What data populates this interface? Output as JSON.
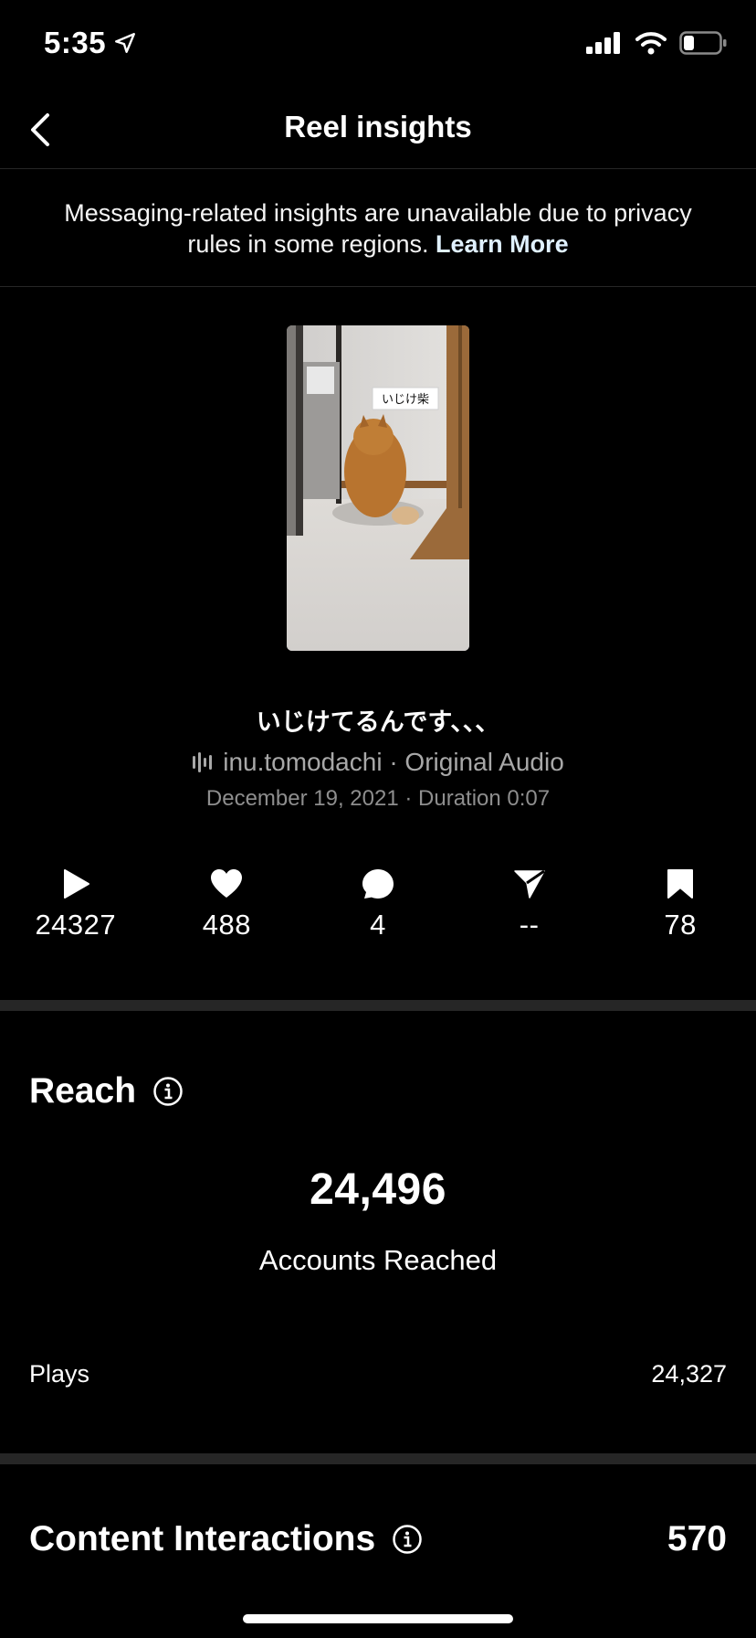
{
  "status_bar": {
    "time": "5:35"
  },
  "nav": {
    "title": "Reel insights"
  },
  "notice": {
    "text": "Messaging-related insights are unavailable due to privacy rules in some regions.",
    "link": "Learn More"
  },
  "reel": {
    "thumbnail_overlay_text": "いじけ柴",
    "caption": "いじけてるんです、、、",
    "audio": "inu.tomodachi · Original Audio",
    "meta": "December 19, 2021 · Duration 0:07"
  },
  "stats": [
    {
      "icon": "play-icon",
      "value": "24327"
    },
    {
      "icon": "heart-icon",
      "value": "488"
    },
    {
      "icon": "comment-icon",
      "value": "4"
    },
    {
      "icon": "share-icon",
      "value": "--"
    },
    {
      "icon": "bookmark-icon",
      "value": "78"
    }
  ],
  "reach": {
    "title": "Reach",
    "accounts_reached": "24,496",
    "accounts_label": "Accounts Reached",
    "plays_label": "Plays",
    "plays_value": "24,327"
  },
  "interactions": {
    "title": "Content Interactions",
    "value": "570"
  }
}
